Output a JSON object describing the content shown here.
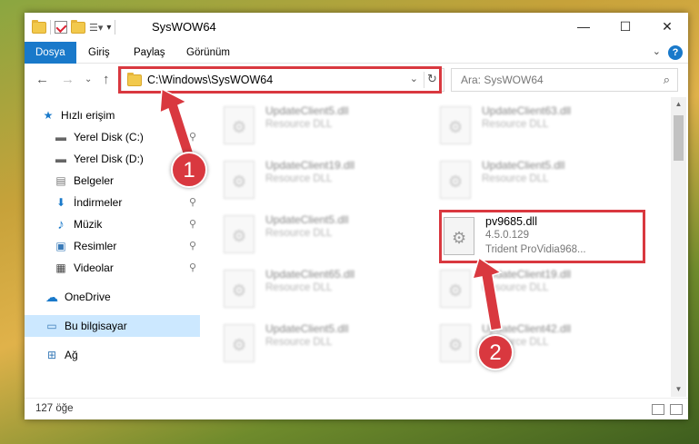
{
  "window": {
    "title": "SysWOW64",
    "controls": {
      "minimize": "—",
      "maximize": "☐",
      "close": "✕"
    }
  },
  "ribbon": {
    "tabs": [
      "Dosya",
      "Giriş",
      "Paylaş",
      "Görünüm"
    ],
    "active_tab": "Dosya",
    "help": "?",
    "expand": "⌄"
  },
  "navigation": {
    "back": "←",
    "forward": "→",
    "recent": "⌄",
    "up": "↑",
    "address": "C:\\Windows\\SysWOW64",
    "refresh": "↻",
    "dropdown": "⌄",
    "search_placeholder": "Ara: SysWOW64",
    "search_icon": "⌕"
  },
  "sidebar": {
    "items": [
      {
        "label": "Hızlı erişim",
        "icon": "star-icon",
        "glyph": "★",
        "pinned": false
      },
      {
        "label": "Yerel Disk (C:)",
        "icon": "drive-icon",
        "glyph": "▬",
        "pinned": true
      },
      {
        "label": "Yerel Disk (D:)",
        "icon": "drive-icon",
        "glyph": "▬",
        "pinned": true
      },
      {
        "label": "Belgeler",
        "icon": "documents-icon",
        "glyph": "▤",
        "pinned": true
      },
      {
        "label": "İndirmeler",
        "icon": "download-icon",
        "glyph": "⬇",
        "pinned": true
      },
      {
        "label": "Müzik",
        "icon": "music-icon",
        "glyph": "♪",
        "pinned": true
      },
      {
        "label": "Resimler",
        "icon": "pictures-icon",
        "glyph": "▣",
        "pinned": true
      },
      {
        "label": "Videolar",
        "icon": "video-icon",
        "glyph": "▦",
        "pinned": true
      },
      {
        "label": "OneDrive",
        "icon": "cloud-icon",
        "glyph": "☁",
        "pinned": false
      },
      {
        "label": "Bu bilgisayar",
        "icon": "computer-icon",
        "glyph": "▭",
        "pinned": false
      },
      {
        "label": "Ağ",
        "icon": "network-icon",
        "glyph": "⊞",
        "pinned": false
      }
    ],
    "selected": "Bu bilgisayar",
    "pin_glyph": "📌"
  },
  "files": [
    {
      "name": "UpdateClient5.dll",
      "desc": "Resource DLL",
      "blurred": true
    },
    {
      "name": "UpdateClient63.dll",
      "desc": "Resource DLL",
      "blurred": true
    },
    {
      "name": "UpdateClient19.dll",
      "desc": "Resource DLL",
      "blurred": true
    },
    {
      "name": "UpdateClient5.dll",
      "desc": "Resource DLL",
      "blurred": true
    },
    {
      "name": "UpdateClient5.dll",
      "desc": "Resource DLL",
      "blurred": true
    },
    {
      "name": "pv9685.dll",
      "desc": "4.5.0.129",
      "desc2": "Trident ProVidia968...",
      "blurred": false
    },
    {
      "name": "UpdateClient65.dll",
      "desc": "Resource DLL",
      "blurred": true
    },
    {
      "name": "UpdateClient19.dll",
      "desc": "Resource DLL",
      "blurred": true
    },
    {
      "name": "UpdateClient5.dll",
      "desc": "Resource DLL",
      "blurred": true
    },
    {
      "name": "UpdateClient42.dll",
      "desc": "Resource DLL",
      "blurred": true
    }
  ],
  "status": {
    "count": "127 öğe"
  },
  "annotations": {
    "step1": "1",
    "step2": "2",
    "color": "#d9383f"
  }
}
